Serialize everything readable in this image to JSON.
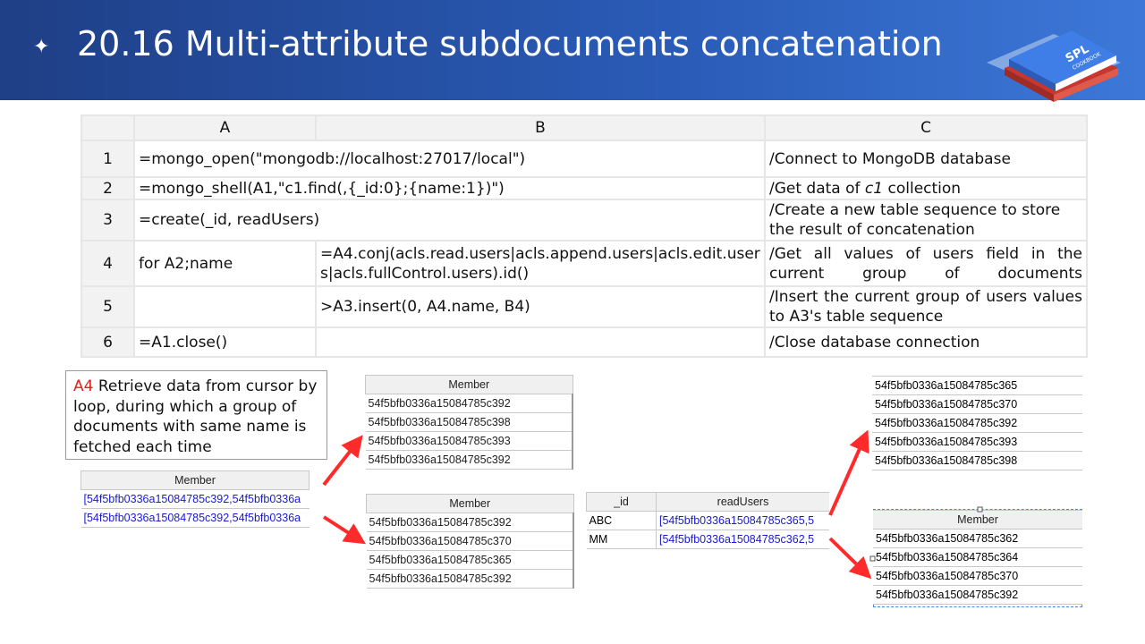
{
  "header": {
    "bullet": "✦",
    "title": "20.16 Multi-attribute subdocuments concatenation",
    "logo_text_1": "SPL",
    "logo_text_2": "COOKBOOK"
  },
  "grid": {
    "columns": [
      "A",
      "B",
      "C"
    ],
    "rows": [
      {
        "num": "1",
        "a": "=mongo_open(\"mongodb://localhost:27017/local\")",
        "b": "",
        "c": "/Connect to MongoDB database"
      },
      {
        "num": "2",
        "a": "=mongo_shell(A1,\"c1.find(,{_id:0};{name:1})\")",
        "b": "",
        "c_prefix": "/Get data of ",
        "c_italic": "c1",
        "c_suffix": " collection"
      },
      {
        "num": "3",
        "a": "=create(_id, readUsers)",
        "b": "",
        "c": "/Create a new table sequence to store the result of concatenation"
      },
      {
        "num": "4",
        "a": "for A2;name",
        "b": "=A4.conj(acls.read.users|acls.append.users|acls.edit.users|acls.fullControl.users).id()",
        "c": "/Get all values of users field in the current group of documents"
      },
      {
        "num": "5",
        "a": "",
        "b": ">A3.insert(0, A4.name, B4)",
        "c": "/Insert the current group of users values to A3's table sequence"
      },
      {
        "num": "6",
        "a": "=A1.close()",
        "b": "",
        "c": "/Close database connection"
      }
    ]
  },
  "note": {
    "label": "A4",
    "text": " Retrieve data from cursor by loop, during which a group of documents with same name is fetched each time"
  },
  "left_member": {
    "header": "Member",
    "rows": [
      "[54f5bfb0336a15084785c392,54f5bfb0336a",
      "[54f5bfb0336a15084785c392,54f5bfb0336a"
    ]
  },
  "member_top": {
    "header": "Member",
    "rows": [
      "54f5bfb0336a15084785c392",
      "54f5bfb0336a15084785c398",
      "54f5bfb0336a15084785c393",
      "54f5bfb0336a15084785c392"
    ]
  },
  "member_bottom": {
    "header": "Member",
    "rows": [
      "54f5bfb0336a15084785c392",
      "54f5bfb0336a15084785c370",
      "54f5bfb0336a15084785c365",
      "54f5bfb0336a15084785c392"
    ]
  },
  "result": {
    "headers": [
      "_id",
      "readUsers"
    ],
    "rows": [
      {
        "id": "ABC",
        "users": "[54f5bfb0336a15084785c365,5"
      },
      {
        "id": "MM",
        "users": "[54f5bfb0336a15084785c362,5"
      }
    ]
  },
  "right_top": {
    "rows": [
      "54f5bfb0336a15084785c365",
      "54f5bfb0336a15084785c370",
      "54f5bfb0336a15084785c392",
      "54f5bfb0336a15084785c393",
      "54f5bfb0336a15084785c398"
    ]
  },
  "right_bottom": {
    "header": "Member",
    "rows": [
      "54f5bfb0336a15084785c362",
      "54f5bfb0336a15084785c364",
      "54f5bfb0336a15084785c370",
      "54f5bfb0336a15084785c392"
    ]
  },
  "colors": {
    "header_bg": "#2a5cb8",
    "arrow": "#ff2a2a",
    "note_label": "#e02020",
    "link_blue": "#1a1acd"
  }
}
